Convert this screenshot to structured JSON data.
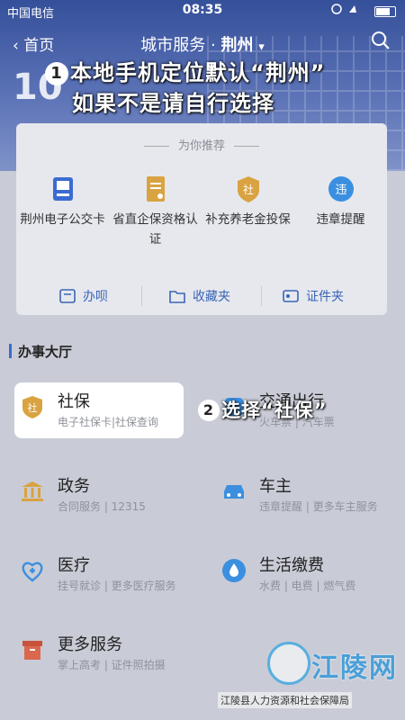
{
  "status": {
    "carrier": "中国电信",
    "time": "08:35",
    "battery_icon": "battery-icon"
  },
  "nav": {
    "back_label": "首页",
    "title_prefix": "城市服务 · ",
    "city": "荆州",
    "city_caret": "▾"
  },
  "header_number": "10",
  "annotation1": {
    "num": "1",
    "line1": "本地手机定位默认“荆州”",
    "line2": "如果不是请自行选择"
  },
  "recommend": {
    "title": "为你推荐",
    "services": [
      {
        "label": "荆州电子公交卡",
        "icon": "bus-card-icon"
      },
      {
        "label": "省直企保资格认证",
        "icon": "document-icon"
      },
      {
        "label": "补充养老金投保",
        "icon": "social-security-shield-icon"
      },
      {
        "label": "违章提醒",
        "icon": "violation-icon"
      }
    ],
    "quick": [
      {
        "label": "办呗",
        "icon": "todo-icon"
      },
      {
        "label": "收藏夹",
        "icon": "folder-icon"
      },
      {
        "label": "证件夹",
        "icon": "id-card-icon"
      }
    ]
  },
  "hall": {
    "title": "办事大厅",
    "items": [
      {
        "name": "社保",
        "sub": "电子社保卡|社保查询",
        "icon": "shield-icon"
      },
      {
        "name": "交通出行",
        "sub": "火车票 | 汽车票",
        "icon": "transit-icon"
      },
      {
        "name": "政务",
        "sub": "合同服务 | 12315",
        "icon": "government-icon"
      },
      {
        "name": "车主",
        "sub": "违章提醒 | 更多车主服务",
        "icon": "car-icon"
      },
      {
        "name": "医疗",
        "sub": "挂号就诊 | 更多医疗服务",
        "icon": "medical-icon"
      },
      {
        "name": "生活缴费",
        "sub": "水费 | 电费 | 燃气费",
        "icon": "water-drop-icon"
      },
      {
        "name": "更多服务",
        "sub": "掌上高考 | 证件照拍摄",
        "icon": "box-icon"
      }
    ]
  },
  "annotation2": {
    "num": "2",
    "text": "选择“社保”"
  },
  "watermark": {
    "logo": "江陵网",
    "caption": "江陵县人力资源和社会保障局"
  },
  "colors": {
    "accent": "#3b6bd1",
    "header": "#35509a"
  }
}
